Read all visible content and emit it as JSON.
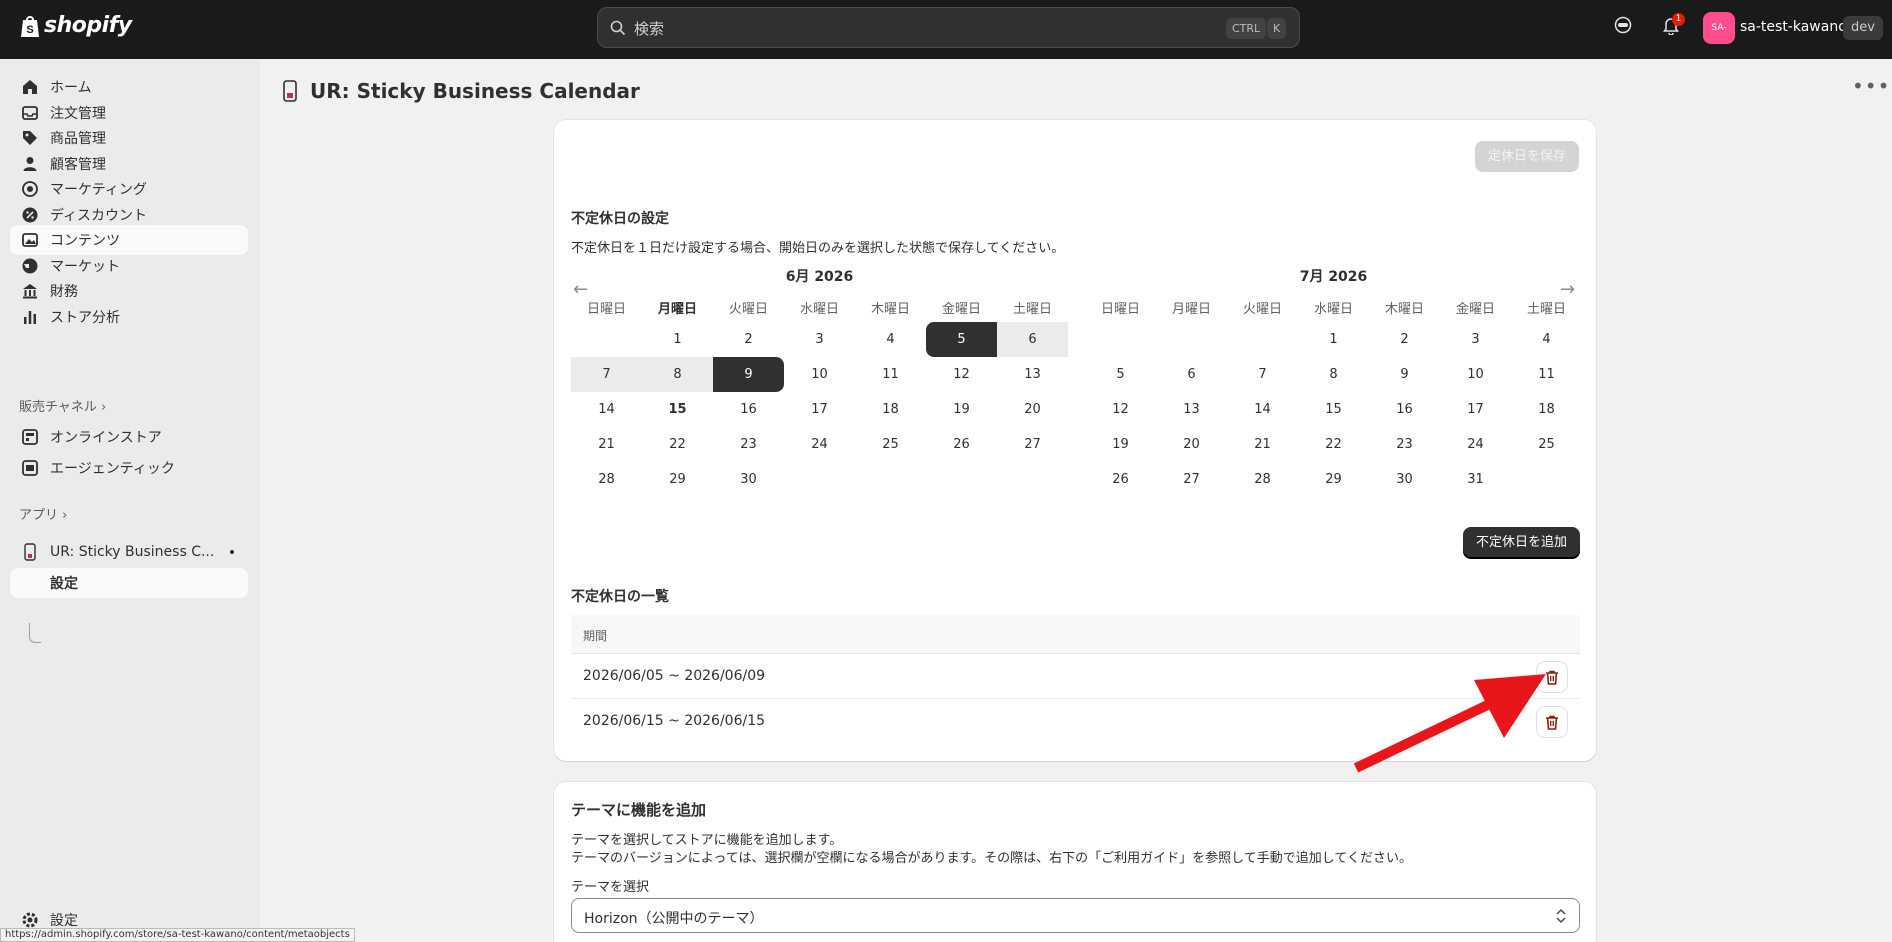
{
  "topbar": {
    "brand": "shopify",
    "search_placeholder": "検索",
    "kbd_ctrl": "CTRL",
    "kbd_k": "K",
    "notifications_count": "1",
    "avatar_initials": "SA-",
    "store_name": "sa-test-kawano",
    "dev_badge": "dev"
  },
  "sidebar": {
    "items": [
      {
        "label": "ホーム",
        "icon": "home-icon"
      },
      {
        "label": "注文管理",
        "icon": "inbox-icon"
      },
      {
        "label": "商品管理",
        "icon": "tag-icon"
      },
      {
        "label": "顧客管理",
        "icon": "person-icon"
      },
      {
        "label": "マーケティング",
        "icon": "target-icon"
      },
      {
        "label": "ディスカウント",
        "icon": "discount-icon"
      },
      {
        "label": "コンテンツ",
        "icon": "image-icon"
      },
      {
        "label": "マーケット",
        "icon": "globe-icon"
      },
      {
        "label": "財務",
        "icon": "bank-icon"
      },
      {
        "label": "ストア分析",
        "icon": "chart-icon"
      }
    ],
    "sales_channels_label": "販売チャネル",
    "channels": [
      {
        "label": "オンラインストア",
        "icon": "store-icon"
      },
      {
        "label": "エージェンティック",
        "icon": "agentic-icon"
      }
    ],
    "apps_label": "アプリ",
    "app_name": "UR: Sticky Business C...",
    "app_sub": "設定",
    "settings_label": "設定"
  },
  "page": {
    "title": "UR: Sticky Business Calendar"
  },
  "holidays_card": {
    "save_button": "定休日を保存",
    "irregular_title": "不定休日の設定",
    "irregular_desc": "不定休日を１日だけ設定する場合、開始日のみを選択した状態で保存してください。",
    "weekdays": [
      "日曜日",
      "月曜日",
      "火曜日",
      "水曜日",
      "木曜日",
      "金曜日",
      "土曜日"
    ],
    "calendars": [
      {
        "month": "6月 2026",
        "first_weekday": 1,
        "days": 30,
        "bold_weekday": 1,
        "today": 15,
        "range_start": 5,
        "range_end": 9
      },
      {
        "month": "7月 2026",
        "first_weekday": 3,
        "days": 31
      }
    ],
    "add_button": "不定休日を追加",
    "list_title": "不定休日の一覧",
    "list_header": "期間",
    "rows": [
      "2026/06/05 ~ 2026/06/09",
      "2026/06/15 ~ 2026/06/15"
    ]
  },
  "theme_card": {
    "title": "テーマに機能を追加",
    "desc1": "テーマを選択してストアに機能を追加します。",
    "desc2": "テーマのバージョンによっては、選択欄が空欄になる場合があります。その際は、右下の「ご利用ガイド」を参照して手動で追加してください。",
    "select_label": "テーマを選択",
    "selected_theme": "Horizon（公開中のテーマ）"
  },
  "status_url": "https://admin.shopify.com/store/sa-test-kawano/content/metaobjects",
  "colors": {
    "topbar": "#1a1a1a",
    "accent_dark": "#303030",
    "trash_red": "#8e1f0b",
    "annotation_arrow": "#e8161b"
  }
}
